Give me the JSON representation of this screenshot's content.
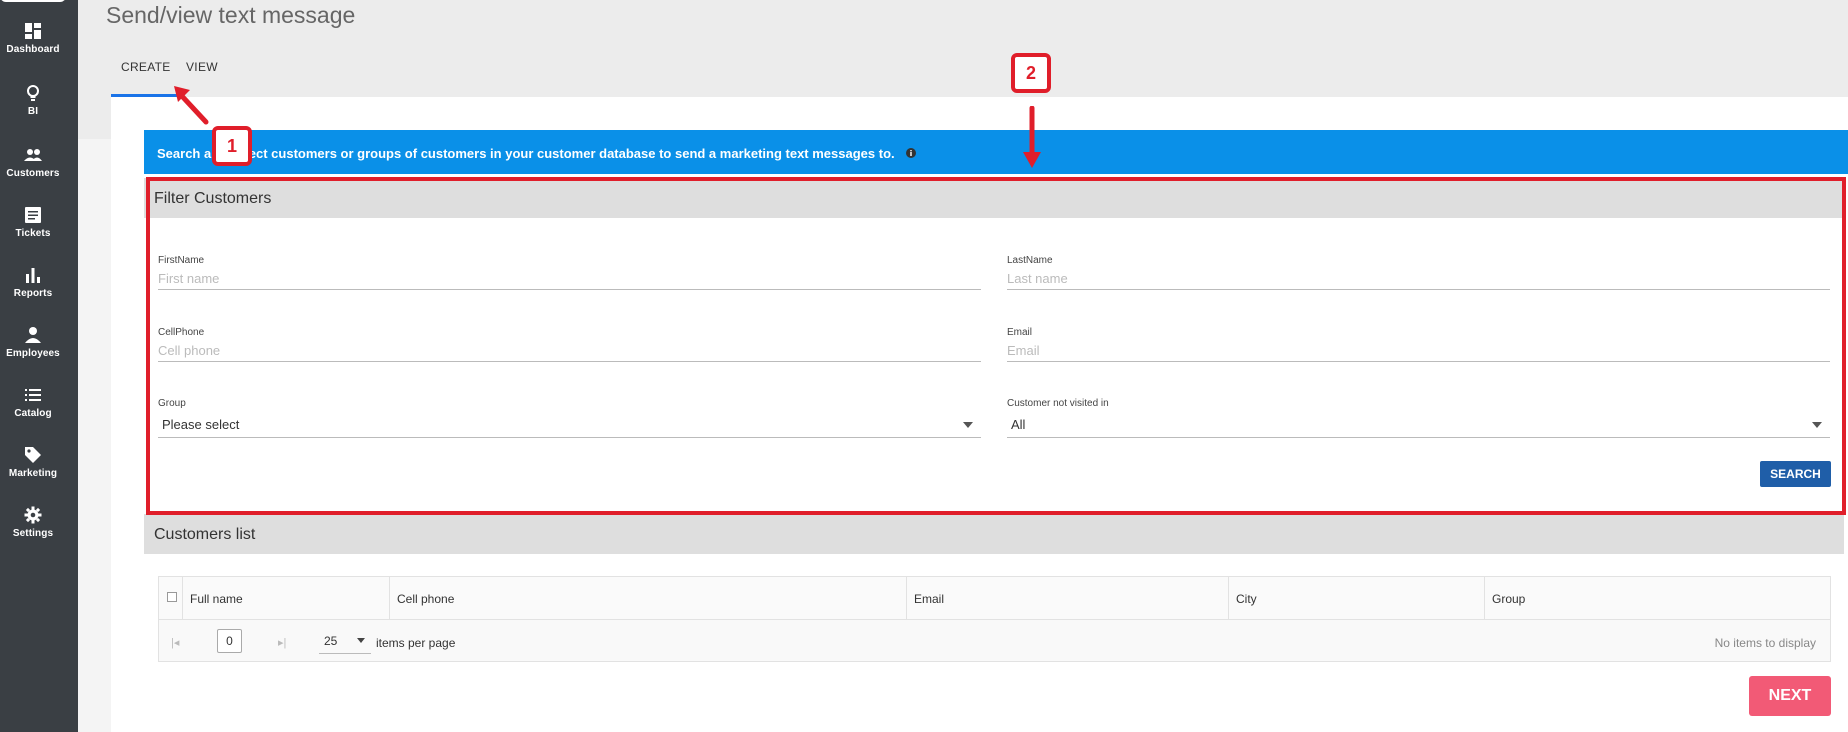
{
  "sidebar": {
    "items": [
      {
        "label": "Dashboard",
        "icon": "dashboard-icon"
      },
      {
        "label": "BI",
        "icon": "lightbulb-icon"
      },
      {
        "label": "Customers",
        "icon": "people-icon"
      },
      {
        "label": "Tickets",
        "icon": "ticket-icon"
      },
      {
        "label": "Reports",
        "icon": "bar-chart-icon"
      },
      {
        "label": "Employees",
        "icon": "person-icon"
      },
      {
        "label": "Catalog",
        "icon": "list-icon"
      },
      {
        "label": "Marketing",
        "icon": "tag-icon"
      },
      {
        "label": "Settings",
        "icon": "gear-icon"
      }
    ]
  },
  "page": {
    "title": "Send/view text message"
  },
  "tabs": {
    "create": "CREATE",
    "view": "VIEW"
  },
  "banner": {
    "text": "Search and select customers or groups of customers in your customer database to send a marketing text messages to."
  },
  "filter": {
    "heading": "Filter Customers",
    "first_name": {
      "label": "FirstName",
      "placeholder": "First name",
      "value": ""
    },
    "last_name": {
      "label": "LastName",
      "placeholder": "Last name",
      "value": ""
    },
    "cell_phone": {
      "label": "CellPhone",
      "placeholder": "Cell phone",
      "value": ""
    },
    "email": {
      "label": "Email",
      "placeholder": "Email",
      "value": ""
    },
    "group": {
      "label": "Group",
      "selected": "Please select"
    },
    "not_visited": {
      "label": "Customer not visited in",
      "selected": "All"
    },
    "search_label": "SEARCH"
  },
  "customers_list": {
    "heading": "Customers list",
    "columns": [
      "Full name",
      "Cell phone",
      "Email",
      "City",
      "Group"
    ],
    "pager": {
      "page": "0",
      "per_page": "25",
      "per_page_label": "items per page",
      "empty_text": "No items to display"
    }
  },
  "next_label": "NEXT",
  "annotations": {
    "callout_1": "1",
    "callout_2": "2",
    "annotation_color": "#e01e2a"
  },
  "colors": {
    "sidebar": "#3a3f44",
    "banner": "#0a90e8",
    "search_button": "#1f5ea8",
    "next_button": "#f25a76",
    "tab_underline": "#1a73e8"
  }
}
